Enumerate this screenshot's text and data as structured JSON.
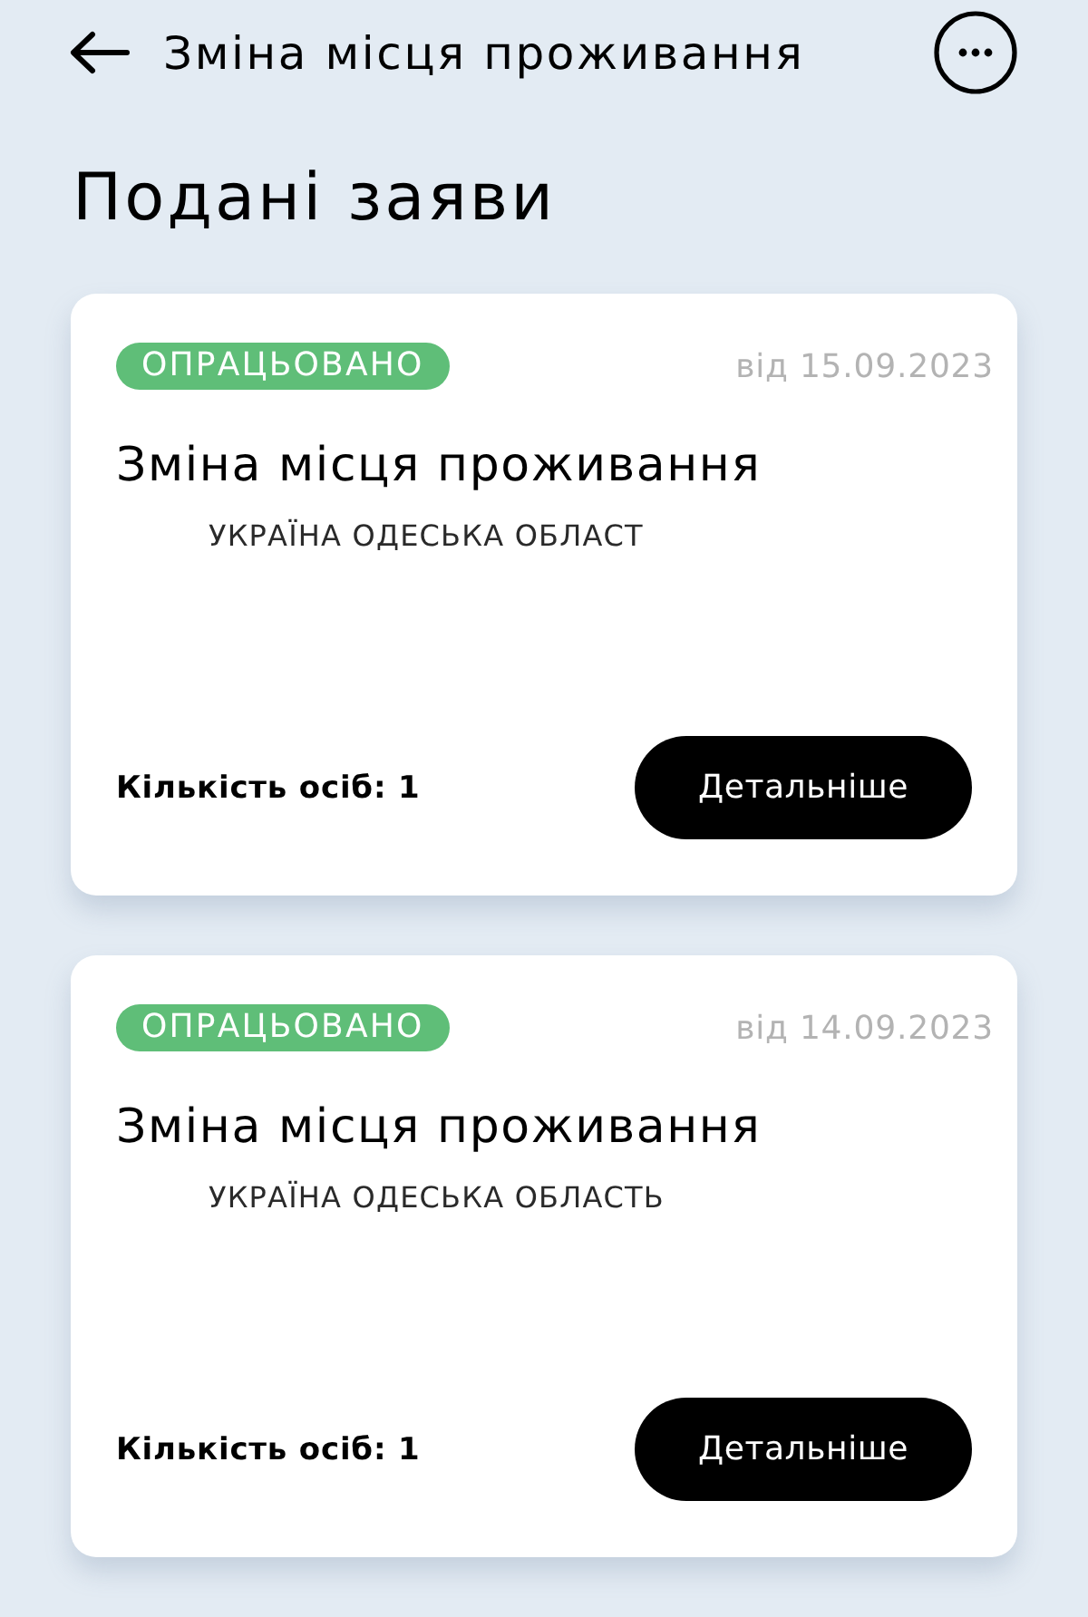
{
  "header": {
    "title": "Зміна місця проживання"
  },
  "page_title": "Подані заяви",
  "applications": [
    {
      "status": "ОПРАЦЬОВАНО",
      "date": "від 15.09.2023",
      "title": "Зміна місця проживання",
      "address": "УКРАЇНА ОДЕСЬКА ОБЛАСТ",
      "persons": "Кількість осіб: 1",
      "button": "Детальніше"
    },
    {
      "status": "ОПРАЦЬОВАНО",
      "date": "від 14.09.2023",
      "title": "Зміна місця проживання",
      "address": "УКРАЇНА ОДЕСЬКА ОБЛАСТЬ",
      "persons": "Кількість осіб: 1",
      "button": "Детальніше"
    }
  ]
}
